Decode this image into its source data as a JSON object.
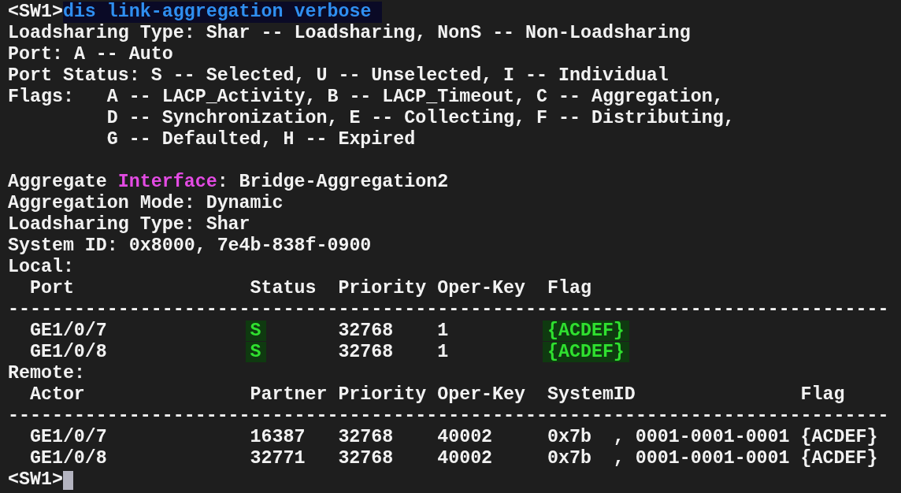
{
  "prompt_line": {
    "prompt": "<SW1>",
    "command": "dis link-aggregation verbose"
  },
  "legend": [
    "Loadsharing Type: Shar -- Loadsharing, NonS -- Non-Loadsharing",
    "Port: A -- Auto",
    "Port Status: S -- Selected, U -- Unselected, I -- Individual"
  ],
  "flags": {
    "label": "Flags:",
    "lines": [
      "A -- LACP_Activity, B -- LACP_Timeout, C -- Aggregation,",
      "D -- Synchronization, E -- Collecting, F -- Distributing,",
      "G -- Defaulted, H -- Expired"
    ]
  },
  "aggregate": [
    {
      "segments": [
        {
          "text": "Aggregate ",
          "kind": "plain"
        },
        {
          "text": "Interface",
          "kind": "keyword"
        },
        {
          "text": ": Bridge-Aggregation2",
          "kind": "plain"
        }
      ]
    },
    {
      "segments": [
        {
          "text": "Aggregation Mode: Dynamic",
          "kind": "plain"
        }
      ]
    },
    {
      "segments": [
        {
          "text": "Loadsharing Type: Shar",
          "kind": "plain"
        }
      ]
    },
    {
      "segments": [
        {
          "text": "System ID: 0x8000, 7e4b-838f-0900",
          "kind": "plain"
        }
      ]
    }
  ],
  "local": {
    "label": "Local:",
    "columns": [
      "Port",
      "Status",
      "Priority",
      "Oper-Key",
      "Flag"
    ],
    "rule": "--------------------------------------------------------------------------------",
    "rows": [
      {
        "cells": [
          {
            "text": "GE1/0/7",
            "highlight": false
          },
          {
            "text": "S",
            "highlight": true
          },
          {
            "text": "32768",
            "highlight": false
          },
          {
            "text": "1",
            "highlight": false
          },
          {
            "text": "{ACDEF}",
            "highlight": true
          }
        ]
      },
      {
        "cells": [
          {
            "text": "GE1/0/8",
            "highlight": false
          },
          {
            "text": "S",
            "highlight": true
          },
          {
            "text": "32768",
            "highlight": false
          },
          {
            "text": "1",
            "highlight": false
          },
          {
            "text": "{ACDEF}",
            "highlight": true
          }
        ]
      }
    ]
  },
  "remote": {
    "label": "Remote:",
    "columns": [
      "Actor",
      "Partner",
      "Priority",
      "Oper-Key",
      "SystemID",
      "Flag"
    ],
    "rule": "--------------------------------------------------------------------------------",
    "rows": [
      {
        "cells": [
          {
            "text": "GE1/0/7",
            "highlight": false
          },
          {
            "text": "16387",
            "highlight": false
          },
          {
            "text": "32768",
            "highlight": false
          },
          {
            "text": "40002",
            "highlight": false
          },
          {
            "text": "0x7b  , 0001-0001-0001",
            "highlight": false
          },
          {
            "text": "{ACDEF}",
            "highlight": false
          }
        ]
      },
      {
        "cells": [
          {
            "text": "GE1/0/8",
            "highlight": false
          },
          {
            "text": "32771",
            "highlight": false
          },
          {
            "text": "32768",
            "highlight": false
          },
          {
            "text": "40002",
            "highlight": false
          },
          {
            "text": "0x7b  , 0001-0001-0001",
            "highlight": false
          },
          {
            "text": "{ACDEF}",
            "highlight": false
          }
        ]
      }
    ]
  },
  "final_prompt": {
    "prompt": "<SW1>",
    "cursor": true
  }
}
